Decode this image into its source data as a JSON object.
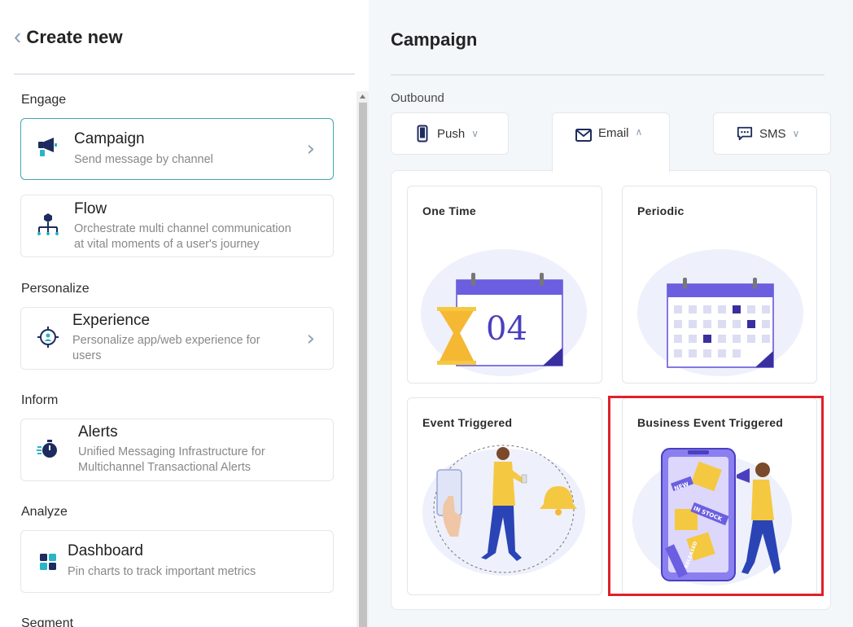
{
  "left": {
    "title": "Create new",
    "sections": [
      {
        "label": "Engage",
        "items": [
          {
            "title": "Campaign",
            "desc1": "Send message by channel",
            "desc2": "",
            "icon": "megaphone-icon"
          },
          {
            "title": "Flow",
            "desc1": "Orchestrate multi channel communication",
            "desc2": "at vital moments of a user's journey",
            "icon": "flow-icon"
          }
        ]
      },
      {
        "label": "Personalize",
        "items": [
          {
            "title": "Experience",
            "desc1": "Personalize app/web experience for",
            "desc2": "users",
            "icon": "target-user-icon"
          }
        ]
      },
      {
        "label": "Inform",
        "items": [
          {
            "title": "Alerts",
            "desc1": "Unified Messaging Infrastructure for",
            "desc2": "Multichannel Transactional Alerts",
            "icon": "stopwatch-icon"
          }
        ]
      },
      {
        "label": "Analyze",
        "items": [
          {
            "title": "Dashboard",
            "desc1": "Pin charts to track important metrics",
            "desc2": "",
            "icon": "dashboard-icon"
          }
        ]
      },
      {
        "label": "Segment",
        "items": []
      }
    ]
  },
  "right": {
    "title": "Campaign",
    "outbound_label": "Outbound",
    "tabs": [
      {
        "label": "Push",
        "icon": "mobile-icon",
        "state": "collapsed"
      },
      {
        "label": "Email",
        "icon": "mail-icon",
        "state": "expanded"
      },
      {
        "label": "SMS",
        "icon": "sms-icon",
        "state": "collapsed"
      }
    ],
    "templates": [
      {
        "title": "One Time",
        "calendar_number": "04"
      },
      {
        "title": "Periodic"
      },
      {
        "title": "Event Triggered"
      },
      {
        "title": "Business Event Triggered",
        "tags": [
          "NEW",
          "IN STOCK",
          "RELEASED"
        ],
        "highlighted": true
      }
    ]
  },
  "colors": {
    "accent_teal": "#3fa7b7",
    "brand_purple": "#5b4fd6",
    "illus_yellow": "#f5c842",
    "highlight_red": "#e0212a",
    "navy": "#1d2b5e"
  }
}
